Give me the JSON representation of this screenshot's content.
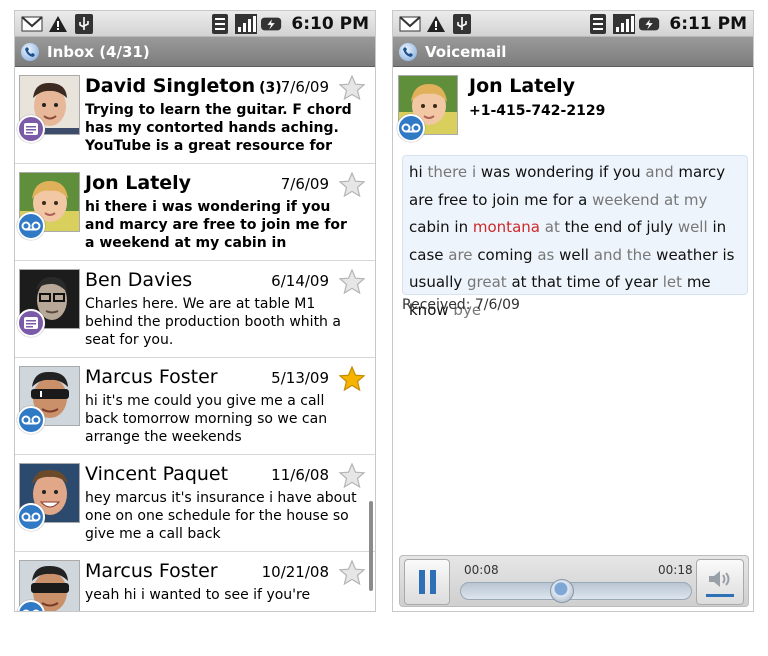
{
  "left": {
    "status_time": "6:10 PM",
    "title": "Inbox (4/31)",
    "messages": [
      {
        "name": "David Singleton",
        "count": "(3)",
        "date": "7/6/09",
        "snippet": "Trying to learn the guitar. F chord has my contorted hands aching. YouTube is a great resource for",
        "type": "text",
        "unread": true,
        "starred": false
      },
      {
        "name": "Jon Lately",
        "count": "",
        "date": "7/6/09",
        "snippet": "hi there i was wondering if you and marcy are free to join me for a weekend at my cabin in montana at",
        "type": "voicemail",
        "unread": true,
        "starred": false
      },
      {
        "name": "Ben Davies",
        "count": "",
        "date": "6/14/09",
        "snippet": "Charles here. We are at table M1 behind the production booth whith a seat for you.",
        "type": "text",
        "unread": false,
        "starred": false
      },
      {
        "name": "Marcus Foster",
        "count": "",
        "date": "5/13/09",
        "snippet": "hi it's me could you give me a call back tomorrow morning so we can arrange the weekends",
        "type": "voicemail",
        "unread": false,
        "starred": true
      },
      {
        "name": "Vincent Paquet",
        "count": "",
        "date": "11/6/08",
        "snippet": "hey marcus it's insurance i have about one on one schedule for the house so give me a call back",
        "type": "voicemail",
        "unread": false,
        "starred": false
      },
      {
        "name": "Marcus Foster",
        "count": "",
        "date": "10/21/08",
        "snippet": "yeah hi i wanted to see if you're",
        "type": "voicemail",
        "unread": false,
        "starred": false
      }
    ]
  },
  "right": {
    "status_time": "6:11 PM",
    "title": "Voicemail",
    "contact_name": "Jon Lately",
    "contact_number": "+1-415-742-2129",
    "transcript": [
      {
        "t": "hi",
        "c": 1
      },
      {
        "t": "there",
        "c": 2
      },
      {
        "t": "i",
        "c": 2
      },
      {
        "t": "was",
        "c": 1
      },
      {
        "t": "wondering",
        "c": 1
      },
      {
        "t": "if",
        "c": 1
      },
      {
        "t": "you",
        "c": 1
      },
      {
        "t": "and",
        "c": 2
      },
      {
        "t": "marcy",
        "c": 1
      },
      {
        "t": "are",
        "c": 1
      },
      {
        "t": "free",
        "c": 1
      },
      {
        "t": "to",
        "c": 1
      },
      {
        "t": "join",
        "c": 1
      },
      {
        "t": "me",
        "c": 1
      },
      {
        "t": "for",
        "c": 1
      },
      {
        "t": "a",
        "c": 1
      },
      {
        "t": "weekend",
        "c": 2
      },
      {
        "t": "at",
        "c": 2
      },
      {
        "t": "my",
        "c": 2
      },
      {
        "t": "cabin",
        "c": 1
      },
      {
        "t": "in",
        "c": 1
      },
      {
        "t": "montana",
        "c": 3
      },
      {
        "t": "at",
        "c": 2
      },
      {
        "t": "the",
        "c": 1
      },
      {
        "t": "end",
        "c": 1
      },
      {
        "t": "of",
        "c": 1
      },
      {
        "t": "july",
        "c": 1
      },
      {
        "t": "well",
        "c": 2
      },
      {
        "t": "in",
        "c": 1
      },
      {
        "t": "case",
        "c": 1
      },
      {
        "t": "are",
        "c": 2
      },
      {
        "t": "coming",
        "c": 1
      },
      {
        "t": "as",
        "c": 2
      },
      {
        "t": "well",
        "c": 1
      },
      {
        "t": "and",
        "c": 2
      },
      {
        "t": "the",
        "c": 2
      },
      {
        "t": "weather",
        "c": 1
      },
      {
        "t": "is",
        "c": 1
      },
      {
        "t": "usually",
        "c": 1
      },
      {
        "t": "great",
        "c": 2
      },
      {
        "t": "at",
        "c": 1
      },
      {
        "t": "that",
        "c": 1
      },
      {
        "t": "time",
        "c": 1
      },
      {
        "t": "of",
        "c": 1
      },
      {
        "t": "year",
        "c": 1
      },
      {
        "t": "let",
        "c": 2
      },
      {
        "t": "me",
        "c": 1
      },
      {
        "t": "know",
        "c": 1
      },
      {
        "t": "bye",
        "c": 2
      }
    ],
    "received": "Received: 7/6/09",
    "player": {
      "current": "00:08",
      "total": "00:18",
      "progress": 0.44
    }
  },
  "colors": {
    "accent": "#2f79c5",
    "star_on": "#f5b400",
    "text_badge": "#7b5aa8"
  }
}
